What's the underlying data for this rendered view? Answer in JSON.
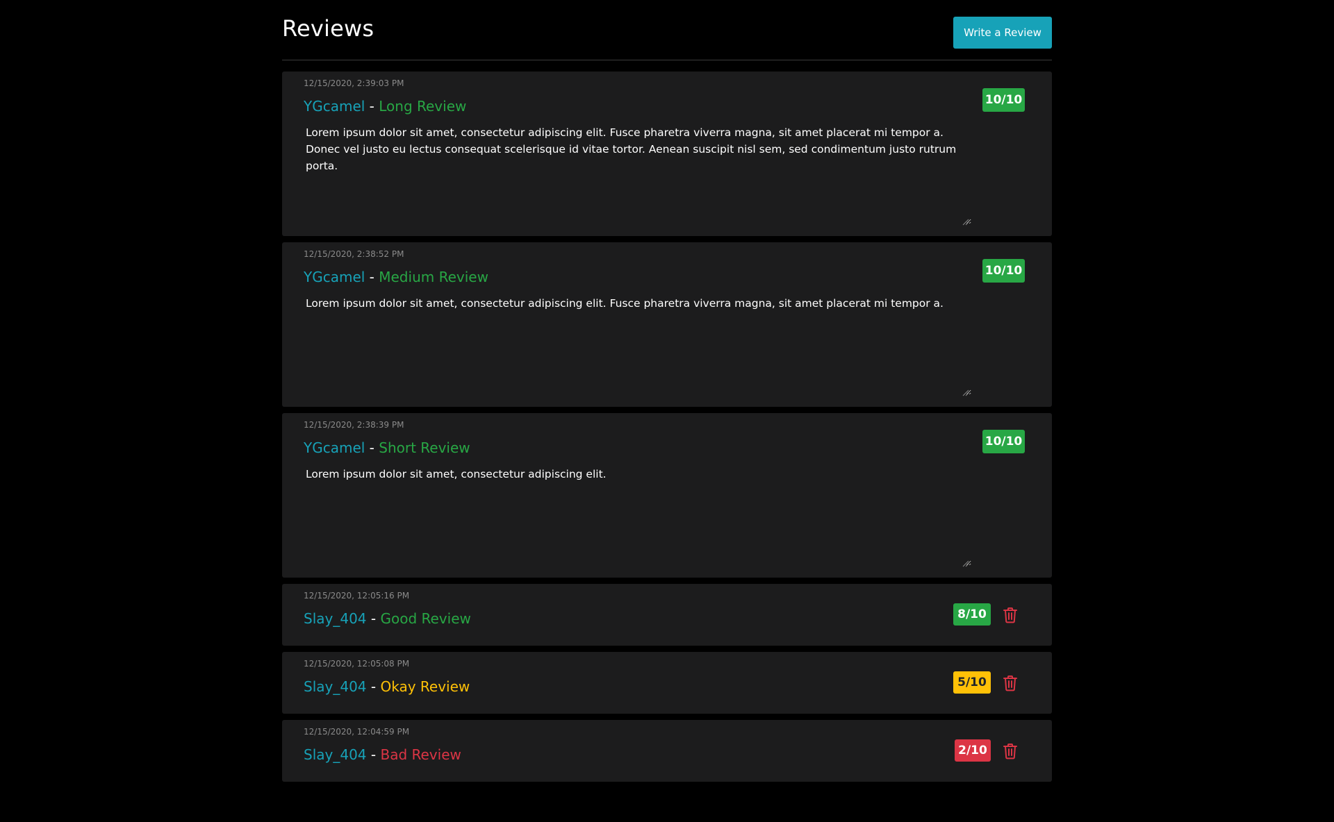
{
  "header": {
    "title": "Reviews",
    "write_button_label": "Write a Review"
  },
  "colors": {
    "background": "#000000",
    "card": "#1c1c1d",
    "accent": "#17a2b8",
    "good": "#28a745",
    "okay": "#ffc107",
    "bad": "#dc3545",
    "timestamp": "#8a8a8a"
  },
  "reviews": [
    {
      "timestamp": "12/15/2020, 2:39:03 PM",
      "author": "YGcamel",
      "separator": "-",
      "title": "Long Review",
      "body": "Lorem ipsum dolor sit amet, consectetur adipiscing elit. Fusce pharetra viverra magna, sit amet placerat mi tempor a. Donec vel justo eu lectus consequat scelerisque id vitae tortor. Aenean suscipit nisl sem, sed condimentum justo rutrum porta.",
      "score": "10/10",
      "rating_color": "green"
    },
    {
      "timestamp": "12/15/2020, 2:38:52 PM",
      "author": "YGcamel",
      "separator": "-",
      "title": "Medium Review",
      "body": "Lorem ipsum dolor sit amet, consectetur adipiscing elit. Fusce pharetra viverra magna, sit amet placerat mi tempor a.",
      "score": "10/10",
      "rating_color": "green"
    },
    {
      "timestamp": "12/15/2020, 2:38:39 PM",
      "author": "YGcamel",
      "separator": "-",
      "title": "Short Review",
      "body": "Lorem ipsum dolor sit amet, consectetur adipiscing elit.",
      "score": "10/10",
      "rating_color": "green"
    },
    {
      "timestamp": "12/15/2020, 12:05:16 PM",
      "author": "Slay_404",
      "separator": "-",
      "title": "Good Review",
      "score": "8/10",
      "rating_color": "green",
      "deletable": true,
      "delete_icon": "trash-icon"
    },
    {
      "timestamp": "12/15/2020, 12:05:08 PM",
      "author": "Slay_404",
      "separator": "-",
      "title": "Okay Review",
      "score": "5/10",
      "rating_color": "yellow",
      "deletable": true,
      "delete_icon": "trash-icon"
    },
    {
      "timestamp": "12/15/2020, 12:04:59 PM",
      "author": "Slay_404",
      "separator": "-",
      "title": "Bad Review",
      "score": "2/10",
      "rating_color": "red",
      "deletable": true,
      "delete_icon": "trash-icon"
    }
  ]
}
